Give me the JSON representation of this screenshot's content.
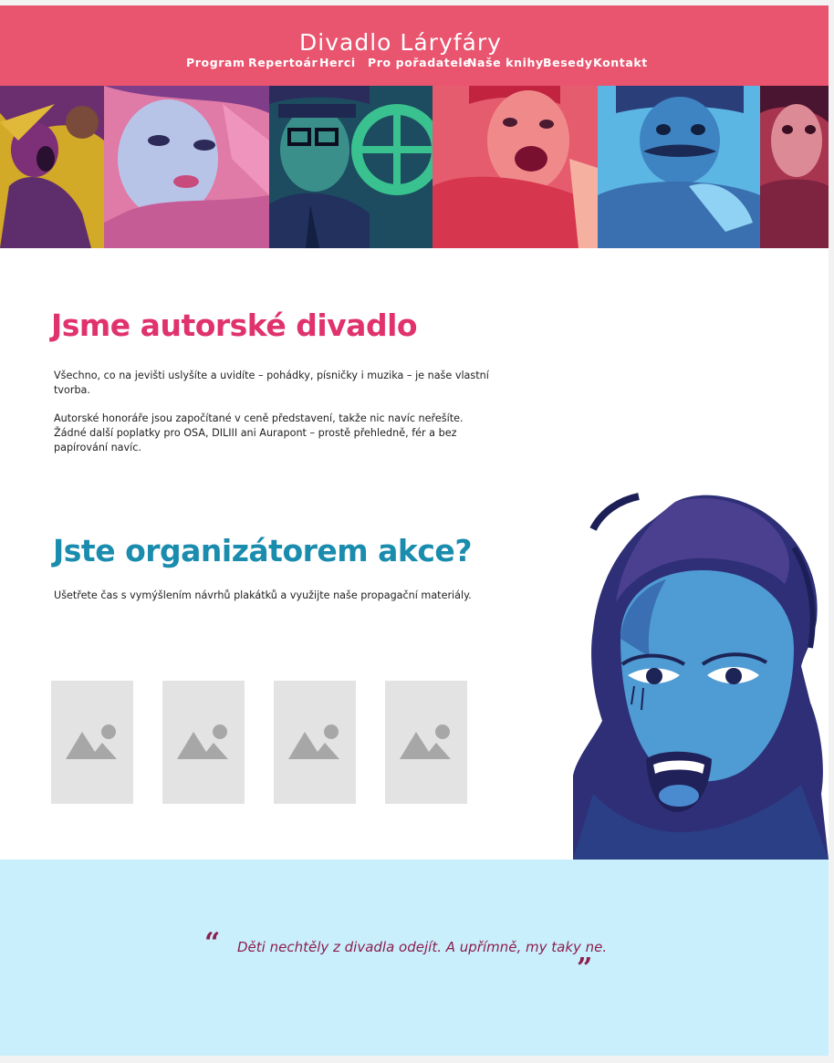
{
  "header": {
    "site_title": "Divadlo Láryfáry",
    "nav": [
      "Program",
      "Repertoár",
      "Herci",
      "Pro pořadatele",
      "Naše knihy",
      "Besedy",
      "Kontakt"
    ]
  },
  "section_author": {
    "heading": "Jsme autorské divadlo",
    "paragraph_1": "Všechno, co na jevišti uslyšíte a uvidíte – pohádky, písničky i muzika – je naše vlastní tvorba.",
    "paragraph_2": "Autorské honoráře jsou započítané v ceně představení, takže nic navíc neřešíte. Žádné další poplatky pro OSA, DILIII ani Aurapont – prostě přehledně, fér a bez papírování navíc."
  },
  "section_organizer": {
    "heading": "Jste organizátorem akce?",
    "paragraph": "Ušetřete čas s vymýšlením návrhů plakátků a využijte naše propagační materiály."
  },
  "quote": {
    "open_mark": "“",
    "text": "Děti nechtěly z divadla odejít. A upřímně, my taky ne.",
    "close_mark": "”"
  },
  "colors": {
    "header_bg": "#e9546f",
    "heading_pink": "#e0326d",
    "heading_blue": "#1a8cad",
    "quote_bg": "#c9effc",
    "quote_text": "#8c1e4c",
    "placeholder_bg": "#e3e3e3"
  },
  "icons": {
    "placeholder": "image-placeholder-icon"
  }
}
